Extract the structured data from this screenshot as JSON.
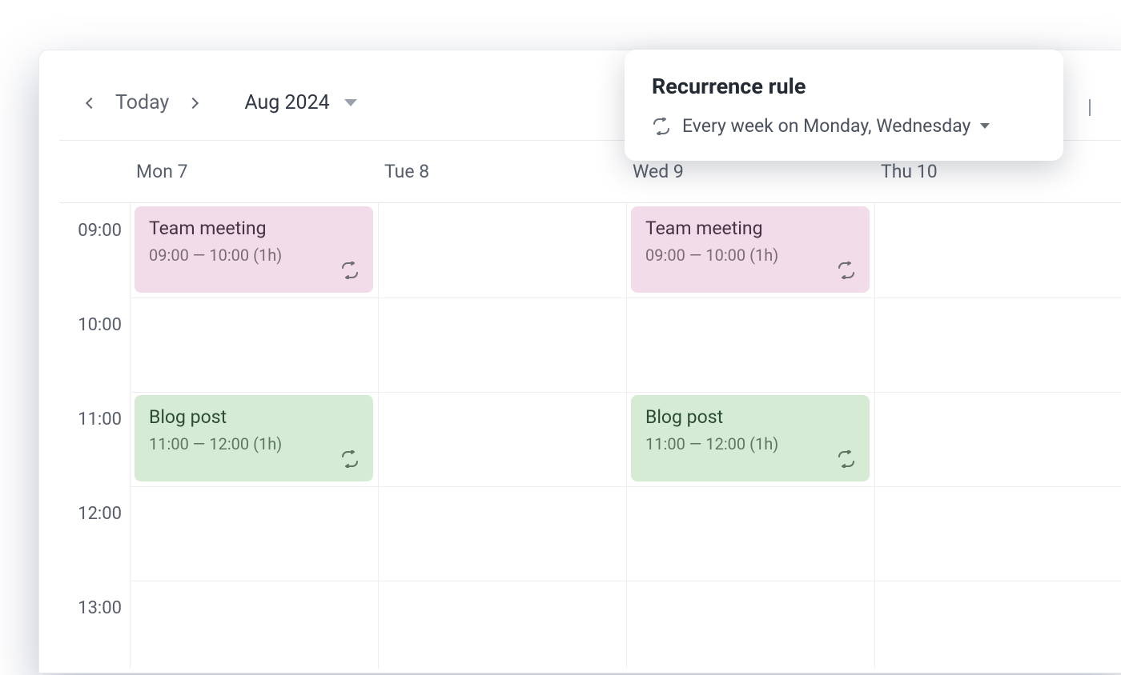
{
  "toolbar": {
    "today_label": "Today",
    "month_label": "Aug 2024"
  },
  "days": [
    "Mon 7",
    "Tue 8",
    "Wed 9",
    "Thu 10"
  ],
  "times": [
    "09:00",
    "10:00",
    "11:00",
    "12:00",
    "13:00"
  ],
  "events": {
    "mon_0900": {
      "title": "Team meeting",
      "time": "09:00 — 10:00 (1h)",
      "color": "pink"
    },
    "wed_0900": {
      "title": "Team meeting",
      "time": "09:00 — 10:00 (1h)",
      "color": "pink"
    },
    "mon_1100": {
      "title": "Blog post",
      "time": "11:00 — 12:00 (1h)",
      "color": "green"
    },
    "wed_1100": {
      "title": "Blog post",
      "time": "11:00 — 12:00 (1h)",
      "color": "green"
    }
  },
  "popover": {
    "title": "Recurrence rule",
    "rule_text": "Every week on Monday, Wednesday"
  }
}
